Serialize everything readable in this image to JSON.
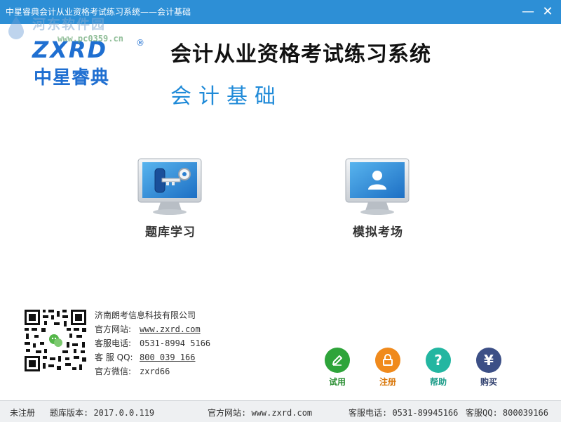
{
  "window": {
    "title": "中星睿典会计从业资格考试练习系统——会计基础",
    "minimize_glyph": "—",
    "close_glyph": "✕"
  },
  "watermark": {
    "name": "河东软件园",
    "url": "www.pc0359.cn"
  },
  "logo": {
    "en": "ZXRD",
    "reg": "®",
    "cn": "中星睿典"
  },
  "header": {
    "title": "会计从业资格考试练习系统",
    "subtitle": "会计基础"
  },
  "tiles": [
    {
      "label": "题库学习",
      "icon": "monitor-key-icon"
    },
    {
      "label": "模拟考场",
      "icon": "monitor-user-icon"
    }
  ],
  "contact": {
    "company": "济南朗考信息科技有限公司",
    "site_label": "官方网站:",
    "site": "www.zxrd.com",
    "phone_label": "客服电话:",
    "phone": "0531-8994 5166",
    "qq_label": "客 服 QQ:",
    "qq": "800 039 166",
    "wechat_label": "官方微信:",
    "wechat": "zxrd66"
  },
  "actions": [
    {
      "label": "试用",
      "icon": "pencil-icon",
      "color": "#2ea43a"
    },
    {
      "label": "注册",
      "icon": "lock-icon",
      "color": "#f08a1c"
    },
    {
      "label": "帮助",
      "icon": "question-icon",
      "glyph": "?",
      "color": "#23b6a1"
    },
    {
      "label": "购买",
      "icon": "yen-icon",
      "glyph": "¥",
      "color": "#3c4f86"
    }
  ],
  "status": {
    "registration": "未注册",
    "version": "题库版本: 2017.0.0.119",
    "site": "官方网站: www.zxrd.com",
    "phone": "客服电话: 0531-89945166",
    "qq": "客服QQ: 800039166"
  },
  "colors": {
    "titlebar": "#2d8fd6",
    "brand_blue": "#1f6fd1",
    "subtitle_blue": "#1f8ad8"
  }
}
